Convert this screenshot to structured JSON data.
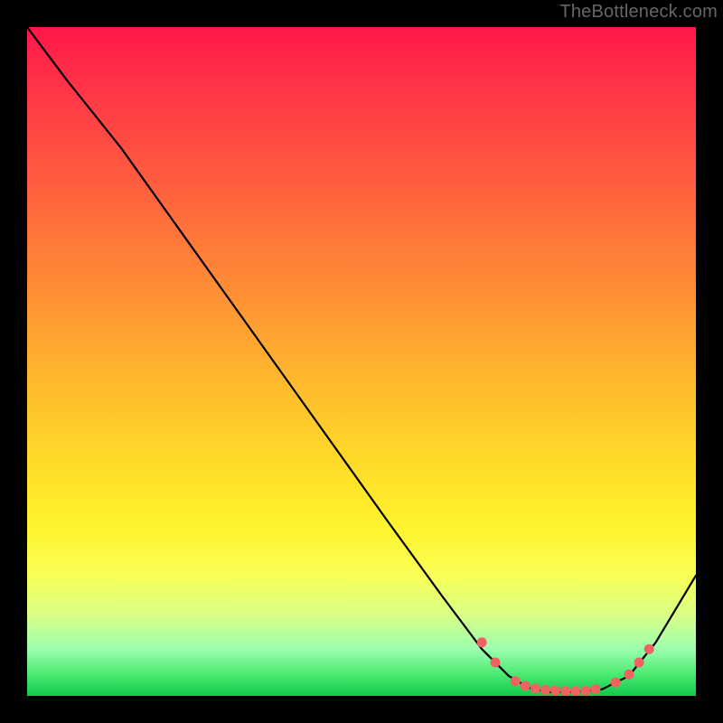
{
  "watermark": "TheBottleneck.com",
  "chart_data": {
    "type": "line",
    "title": "",
    "xlabel": "",
    "ylabel": "",
    "xlim": [
      0,
      100
    ],
    "ylim": [
      0,
      100
    ],
    "curve": [
      {
        "x": 0,
        "y": 100
      },
      {
        "x": 6,
        "y": 92
      },
      {
        "x": 14,
        "y": 82
      },
      {
        "x": 24,
        "y": 68
      },
      {
        "x": 34,
        "y": 54
      },
      {
        "x": 44,
        "y": 40
      },
      {
        "x": 54,
        "y": 26
      },
      {
        "x": 62,
        "y": 15
      },
      {
        "x": 68,
        "y": 7
      },
      {
        "x": 72,
        "y": 3
      },
      {
        "x": 75,
        "y": 1.2
      },
      {
        "x": 78,
        "y": 0.6
      },
      {
        "x": 82,
        "y": 0.6
      },
      {
        "x": 86,
        "y": 1.0
      },
      {
        "x": 90,
        "y": 3
      },
      {
        "x": 94,
        "y": 8
      },
      {
        "x": 100,
        "y": 18
      }
    ],
    "markers": [
      {
        "x": 68,
        "y": 8
      },
      {
        "x": 70,
        "y": 5
      },
      {
        "x": 73,
        "y": 2.2
      },
      {
        "x": 74.5,
        "y": 1.5
      },
      {
        "x": 76,
        "y": 1.1
      },
      {
        "x": 77.5,
        "y": 0.9
      },
      {
        "x": 79,
        "y": 0.8
      },
      {
        "x": 80.5,
        "y": 0.7
      },
      {
        "x": 82,
        "y": 0.7
      },
      {
        "x": 83.5,
        "y": 0.8
      },
      {
        "x": 85,
        "y": 1.0
      },
      {
        "x": 88,
        "y": 2.0
      },
      {
        "x": 90,
        "y": 3.2
      },
      {
        "x": 91.5,
        "y": 5.0
      },
      {
        "x": 93,
        "y": 7.0
      }
    ],
    "marker_color": "#ef6360",
    "line_color": "#000000"
  }
}
